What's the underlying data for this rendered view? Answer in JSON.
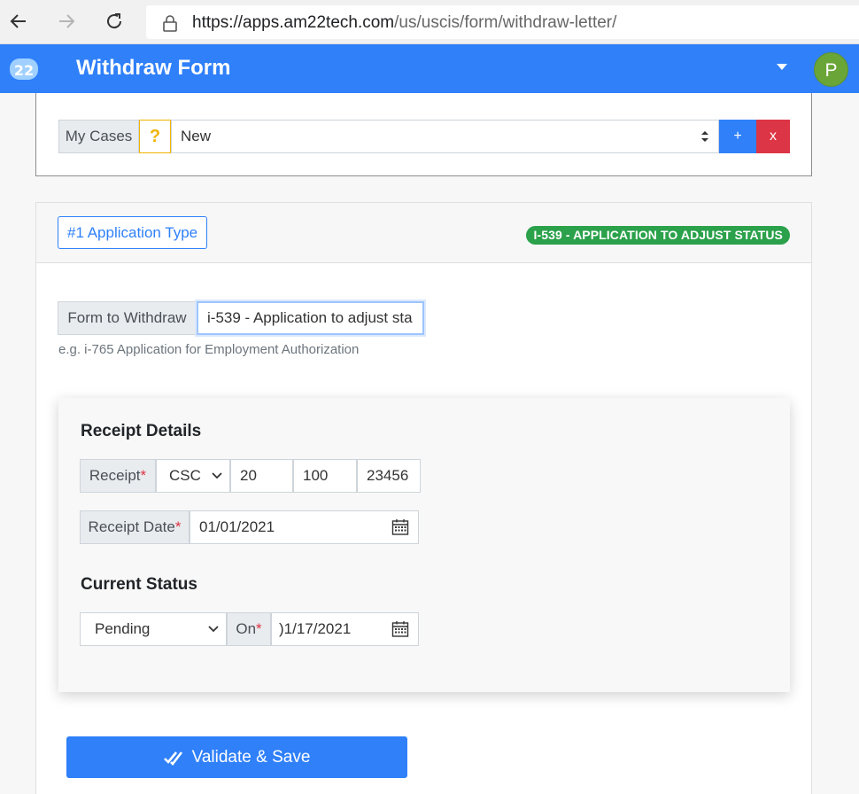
{
  "browser": {
    "url_host": "https://apps.am22tech.com",
    "url_path": "/us/uscis/form/withdraw-letter/"
  },
  "header": {
    "logo_text": "22",
    "title": "Withdraw Form",
    "avatar_initial": "P"
  },
  "cases": {
    "label": "My Cases",
    "help": "?",
    "selected": "New",
    "add_label": "+",
    "delete_label": "x"
  },
  "application": {
    "type_button": "#1 Application Type",
    "status_badge": "I-539 - APPLICATION TO ADJUST STATUS",
    "form_label": "Form to Withdraw",
    "form_value": "i-539 - Application to adjust sta",
    "form_hint": "e.g. i-765 Application for Employment Authorization"
  },
  "receipt": {
    "title": "Receipt Details",
    "receipt_label": "Receipt",
    "center": "CSC",
    "part1": "20",
    "part2": "100",
    "part3": "23456",
    "date_label": "Receipt Date",
    "date_value": "01/01/2021",
    "required_mark": "*"
  },
  "current_status": {
    "title": "Current Status",
    "status": "Pending",
    "on_label": "On",
    "on_date": ")1/17/2021"
  },
  "actions": {
    "save_label": "Validate & Save"
  },
  "colors": {
    "primary": "#2f80f9",
    "danger": "#dc3545",
    "success": "#2aa14a",
    "warning": "#f0b400",
    "avatar": "#6aa537"
  }
}
